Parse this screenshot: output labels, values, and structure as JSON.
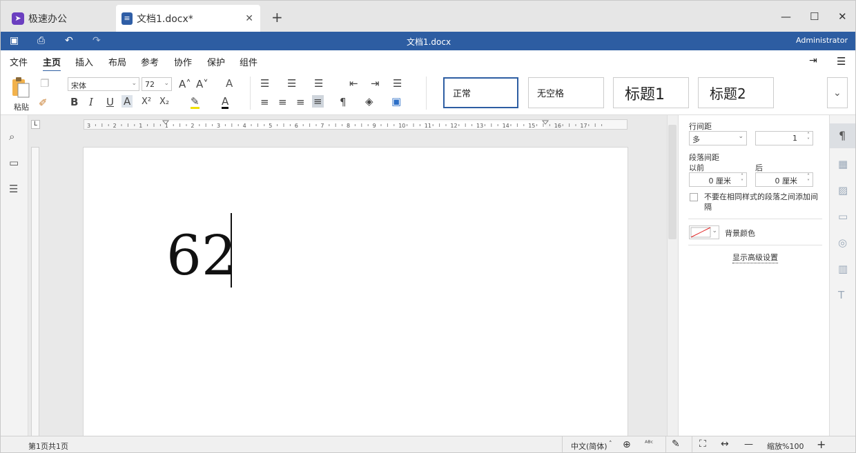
{
  "tabs": {
    "app": "极速办公",
    "doc": "文档1.docx*",
    "close": "✕",
    "new": "+"
  },
  "window": {
    "min": "—",
    "max": "☐",
    "close": "✕"
  },
  "quickbar": {
    "title": "文档1.docx",
    "user": "Administrator"
  },
  "menu": [
    "文件",
    "主页",
    "插入",
    "布局",
    "参考",
    "协作",
    "保护",
    "组件"
  ],
  "ribbon": {
    "paste_label": "粘贴",
    "font_name": "宋体",
    "font_size": "72",
    "bold": "B",
    "italic": "I",
    "underline": "U",
    "strike": "A",
    "superscript": "X²",
    "subscript": "X₂",
    "grow": "A˄",
    "shrink": "A˅",
    "clear": "A",
    "highlight": "✎",
    "font_color": "A",
    "styles": [
      "正常",
      "无空格",
      "标题1",
      "标题2"
    ]
  },
  "document": {
    "text": "62"
  },
  "ruler": {
    "ticks": [
      "3",
      "2",
      "1",
      "1",
      "2",
      "3",
      "4",
      "5",
      "6",
      "7",
      "8",
      "9",
      "10",
      "11",
      "12",
      "13",
      "14",
      "15",
      "16",
      "17"
    ]
  },
  "panel": {
    "line_spacing_label": "行间距",
    "line_spacing_type": "多",
    "line_spacing_value": "1",
    "para_spacing_label": "段落间距",
    "before_label": "以前",
    "after_label": "后",
    "before_value": "0 厘米",
    "after_value": "0 厘米",
    "no_space_checkbox": "不要在相同样式的段落之间添加间隔",
    "bg_color_label": "背景颜色",
    "advanced_link": "显示高级设置"
  },
  "status": {
    "page": "第1页共1页",
    "language": "中文(简体)",
    "zoom": "缩放%100",
    "zoom_out": "—",
    "zoom_in": "+"
  },
  "colors": {
    "accent": "#2d5da2",
    "app_icon": "#6b3fc0"
  }
}
